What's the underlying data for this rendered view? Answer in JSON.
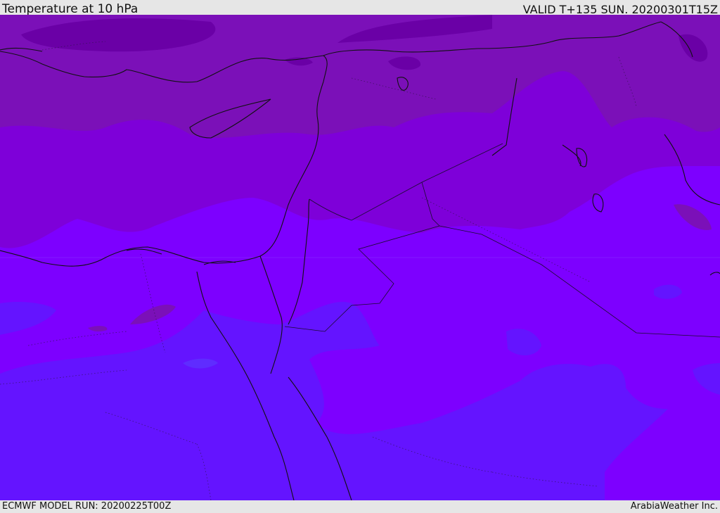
{
  "header": {
    "title": "Temperature at 10 hPa",
    "valid_time": "VALID T+135 SUN. 20200301T15Z"
  },
  "footer": {
    "model_run": "ECMWF MODEL RUN: 20200225T00Z",
    "credit": "ArabiaWeather Inc."
  },
  "colors": {
    "band_darkest": "#6a00a6",
    "band_dark": "#7b10b8",
    "band_mid": "#7e00d9",
    "band_bright": "#7d00ff",
    "band_blue": "#6414ff",
    "band_blue_light": "#5f2cff",
    "coastline": "#111111"
  }
}
